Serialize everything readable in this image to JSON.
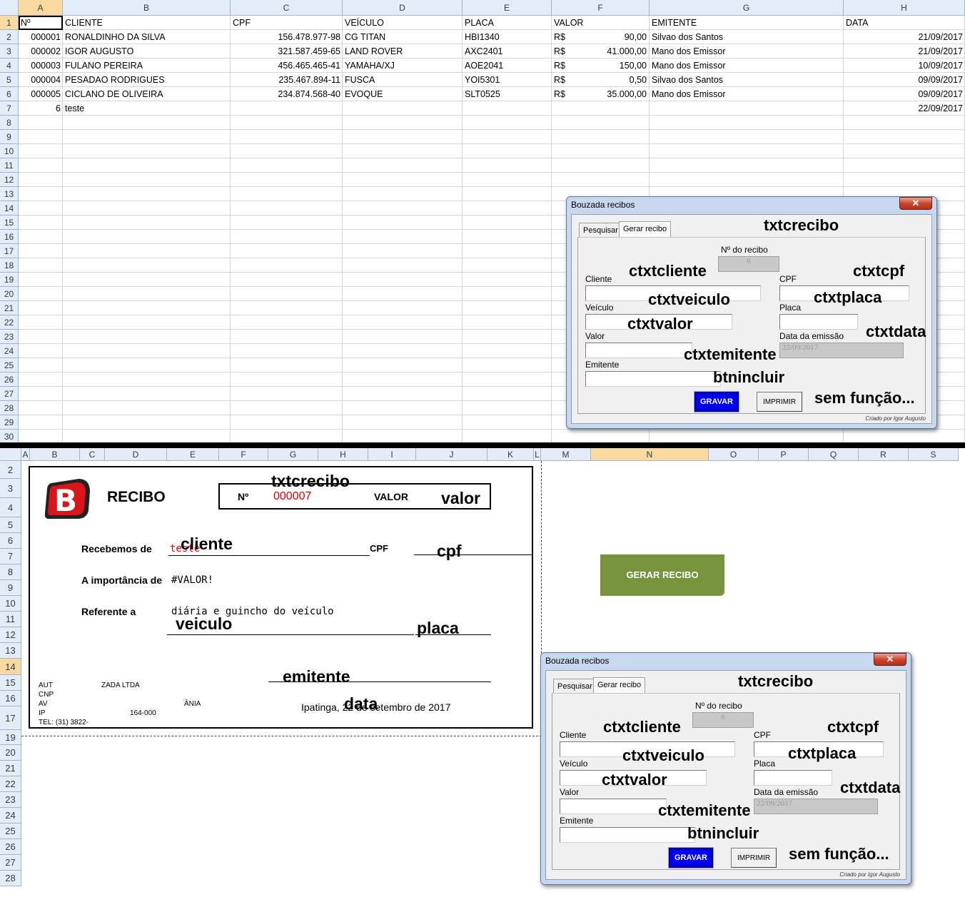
{
  "top_sheet": {
    "columns": [
      "A",
      "B",
      "C",
      "D",
      "E",
      "F",
      "G",
      "H"
    ],
    "rows": [
      "1",
      "2",
      "3",
      "4",
      "5",
      "6",
      "7",
      "8",
      "9",
      "10",
      "11",
      "12",
      "13",
      "14",
      "15",
      "16",
      "17",
      "18",
      "19",
      "20",
      "21",
      "22",
      "23",
      "24",
      "25",
      "26",
      "27",
      "28",
      "29",
      "30"
    ],
    "headers": [
      "Nº",
      "CLIENTE",
      "CPF",
      "VEÍCULO",
      "PLACA",
      "VALOR",
      "EMITENTE",
      "DATA"
    ],
    "records": [
      {
        "num": "000001",
        "cliente": "RONALDINHO DA SILVA",
        "cpf": "156.478.977-98",
        "veiculo": "CG TITAN",
        "placa": "HBI1340",
        "moeda": "R$",
        "valor": "90,00",
        "emitente": "Silvao dos Santos",
        "data": "21/09/2017"
      },
      {
        "num": "000002",
        "cliente": "IGOR AUGUSTO",
        "cpf": "321.587.459-65",
        "veiculo": "LAND ROVER",
        "placa": "AXC2401",
        "moeda": "R$",
        "valor": "41.000,00",
        "emitente": "Mano dos Emissor",
        "data": "21/09/2017"
      },
      {
        "num": "000003",
        "cliente": "FULANO PEREIRA",
        "cpf": "456.465.465-41",
        "veiculo": "YAMAHA/XJ",
        "placa": "AOE2041",
        "moeda": "R$",
        "valor": "150,00",
        "emitente": "Mano dos Emissor",
        "data": "10/09/2017"
      },
      {
        "num": "000004",
        "cliente": "PESADAO RODRIGUES",
        "cpf": "235.467.894-11",
        "veiculo": "FUSCA",
        "placa": "YOI5301",
        "moeda": "R$",
        "valor": "0,50",
        "emitente": "Silvao dos Santos",
        "data": "09/09/2017"
      },
      {
        "num": "000005",
        "cliente": "CICLANO DE OLIVEIRA",
        "cpf": "234.874.568-40",
        "veiculo": "EVOQUE",
        "placa": "SLT0525",
        "moeda": "R$",
        "valor": "35.000,00",
        "emitente": "Mano dos Emissor",
        "data": "09/09/2017"
      },
      {
        "num": "6",
        "cliente": "teste",
        "cpf": "",
        "veiculo": "",
        "placa": "",
        "moeda": "",
        "valor": "",
        "emitente": "",
        "data": "22/09/2017"
      }
    ]
  },
  "bottom_sheet": {
    "columns": [
      "A",
      "B",
      "C",
      "D",
      "E",
      "F",
      "G",
      "H",
      "I",
      "J",
      "K",
      "L",
      "M",
      "N",
      "O",
      "P",
      "Q",
      "R",
      "S"
    ],
    "rows": [
      "2",
      "3",
      "4",
      "5",
      "6",
      "7",
      "8",
      "9",
      "10",
      "11",
      "12",
      "13",
      "14",
      "15",
      "16",
      "17",
      "19",
      "20",
      "21",
      "22",
      "23",
      "24",
      "25",
      "26",
      "27",
      "28"
    ],
    "receipt": {
      "logo_letter": "B",
      "title": "RECIBO",
      "num_label": "Nº",
      "num_value": "000007",
      "valor_label": "VALOR",
      "recebemos_label": "Recebemos de",
      "cliente_value": "teste",
      "cpf_label": "CPF",
      "importancia_label": "A importância de",
      "importancia_value": "#VALOR!",
      "referente_label": "Referente a",
      "referente_value": "diária e guincho do veículo",
      "location_date": "Ipatinga, 22 de setembro de 2017",
      "footer": [
        "AUT",
        "CNP",
        "AV",
        "IP",
        "TEL: (31) 3822-"
      ],
      "footer_fragments": [
        "ZADA LTDA",
        "ÂNIA",
        "164-000"
      ]
    },
    "annotations": {
      "txtcrecibo": "txtcrecibo",
      "valor": "valor",
      "cliente": "cliente",
      "cpf": "cpf",
      "veiculo": "veiculo",
      "placa": "placa",
      "emitente": "emitente",
      "data": "data"
    },
    "gerar_button": "GERAR RECIBO"
  },
  "dialog": {
    "title": "Bouzada recibos",
    "close": "✕",
    "tabs": [
      "Pesquisar",
      "Gerar recibo"
    ],
    "num_label": "Nº do recibo",
    "num_value": "6",
    "cliente_label": "Cliente",
    "cpf_label": "CPF",
    "veiculo_label": "Veículo",
    "placa_label": "Placa",
    "valor_label": "Valor",
    "data_label": "Data da emissão",
    "data_value": "22/09/2017",
    "emitente_label": "Emitente",
    "gravar": "GRAVAR",
    "imprimir": "IMPRIMIR",
    "credit": "Criado por Igor Augusto",
    "annotations": {
      "txtcrecibo": "txtcrecibo",
      "ctxtcliente": "ctxtcliente",
      "ctxtcpf": "ctxtcpf",
      "ctxtveiculo": "ctxtveiculo",
      "ctxtplaca": "ctxtplaca",
      "ctxtvalor": "ctxtvalor",
      "ctxtdata": "ctxtdata",
      "ctxtemitente": "ctxtemitente",
      "btnincluir": "btnincluir",
      "sem_funcao": "sem função..."
    }
  }
}
